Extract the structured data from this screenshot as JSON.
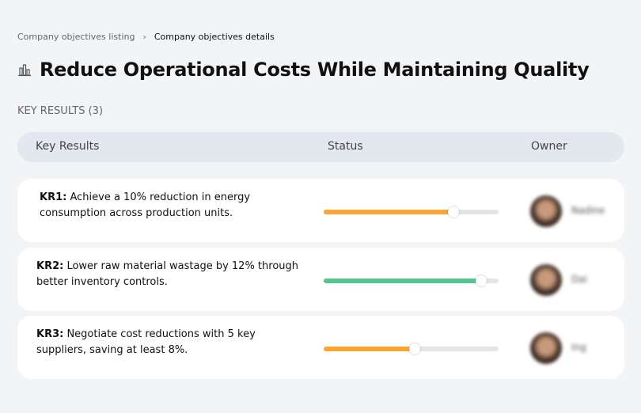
{
  "breadcrumb": {
    "parent": "Company objectives listing",
    "separator": "›",
    "current": "Company objectives details"
  },
  "title": "Reduce Operational Costs While Maintaining Quality",
  "title_icon": "building-chart-icon",
  "section_label": "KEY RESULTS (3)",
  "columns": {
    "key_results": "Key Results",
    "status": "Status",
    "owner": "Owner"
  },
  "colors": {
    "orange": "#fba632",
    "green": "#55c58f"
  },
  "key_results": [
    {
      "id": "KR1:",
      "text": " Achieve a 10% reduction in energy consumption across production units.",
      "progress": 74,
      "color": "#fba632",
      "owner": "Nadine"
    },
    {
      "id": "KR2:",
      "text": " Lower raw material wastage by 12% through better inventory controls.",
      "progress": 90,
      "color": "#55c58f",
      "owner": "Dai"
    },
    {
      "id": "KR3:",
      "text": " Negotiate cost reductions with 5 key suppliers, saving at least 8%.",
      "progress": 52,
      "color": "#fba632",
      "owner": "Ing"
    }
  ]
}
